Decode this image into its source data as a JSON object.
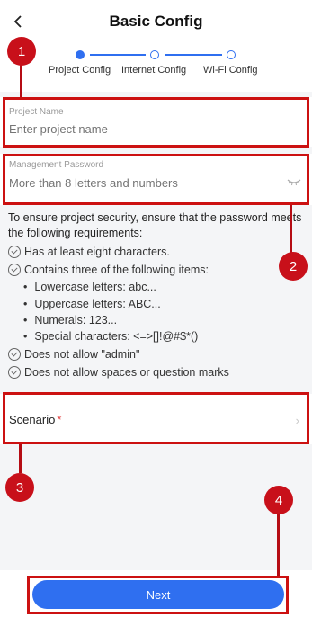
{
  "header": {
    "title": "Basic Config",
    "back_icon": "chevron-left-icon"
  },
  "steps": [
    {
      "label": "Project Config",
      "active": true
    },
    {
      "label": "Internet Config",
      "active": false
    },
    {
      "label": "Wi-Fi Config",
      "active": false
    }
  ],
  "project_name": {
    "label": "Project Name",
    "placeholder": "Enter project name"
  },
  "management_password": {
    "label": "Management Password",
    "placeholder": "More than 8 letters and numbers",
    "visibility_icon": "eye-closed-icon"
  },
  "requirements": {
    "intro": "To ensure project security, ensure that the password meets the following requirements:",
    "rule1": "Has at least eight characters.",
    "rule2": "Contains three of the following items:",
    "sub1": "Lowercase letters: abc...",
    "sub2": "Uppercase letters: ABC...",
    "sub3": "Numerals: 123...",
    "sub4": "Special characters: <=>[]!@#$*()",
    "rule3": "Does not allow \"admin\"",
    "rule4": "Does not allow spaces or question marks"
  },
  "scenario": {
    "label": "Scenario",
    "required_mark": "*",
    "chevron_icon": "chevron-right-icon"
  },
  "next_button": {
    "label": "Next"
  },
  "annotations": {
    "c1": "1",
    "c2": "2",
    "c3": "3",
    "c4": "4"
  },
  "colors": {
    "accent": "#2f6ff0",
    "annotation_red": "#cc1111",
    "background": "#f4f5f7"
  }
}
